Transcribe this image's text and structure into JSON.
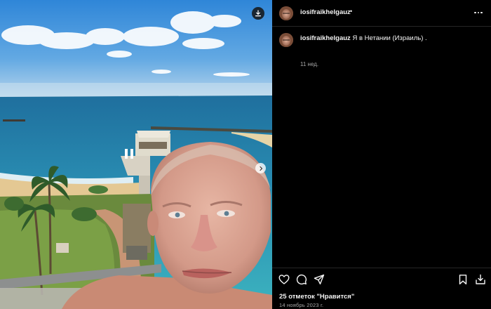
{
  "post": {
    "username": "iosifraikhelgauz",
    "header_separator": "•",
    "caption_text": "Я в Нетании (Израиль) .",
    "caption_time": "11 нед.",
    "likes_text": "25 отметок \"Нравится\"",
    "date_text": "14 ноябрь 2023 г."
  },
  "icons": {
    "download": "download-icon",
    "next": "chevron-right-icon",
    "more": "more-horizontal-icon",
    "like": "heart-icon",
    "comment": "comment-icon",
    "share": "send-icon",
    "save": "bookmark-icon",
    "repost": "repost-icon"
  },
  "colors": {
    "background": "#000000",
    "text": "#f5f5f5",
    "secondary_text": "#a8a8a8",
    "divider": "#262626"
  }
}
